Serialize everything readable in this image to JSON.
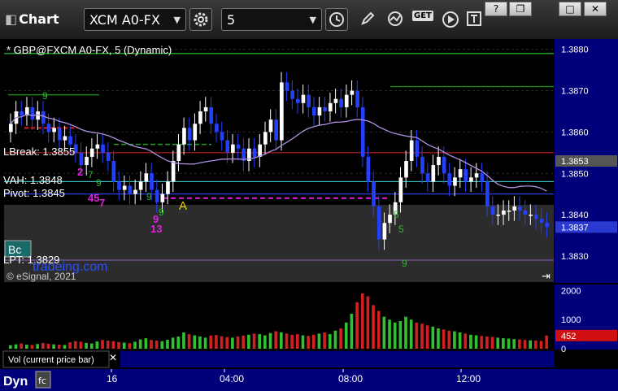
{
  "toolbar": {
    "app_label": "Chart",
    "symbol": "XCM A0-FX",
    "interval": "5",
    "get_label": "GET"
  },
  "chart_header": "* GBP@FXCM A0-FX, 5 (Dynamic)",
  "copyright": "© eSignal, 2021",
  "vol_label": "Vol (current price bar)",
  "dyn_label": "Dyn",
  "studies": {
    "lbreak": "LBreak: 1.3855",
    "vah": "VAH: 1.3848",
    "pivot": "Pivot: 1.3845",
    "lpt": "LPT: 1.3829",
    "watermark": "tradeing.com",
    "marker_a": "A",
    "badge": "Bc"
  },
  "colors": {
    "bull_candle": "#ffffff",
    "bear_candle": "#2440ff",
    "vah_line": "#40e0e0",
    "pivot_line": "#3040ff",
    "lbreak_line": "#c02020",
    "vwap_line": "#b090e0",
    "lpt_line": "#9060c0",
    "top_green_line": "#20a020",
    "current_price_tag": "#2a3ad0",
    "vol_tag": "#d01010"
  },
  "chart_data": [
    {
      "type": "candlestick",
      "title": "* GBP@FXCM A0-FX, 5 (Dynamic)",
      "y_ticks": [
        1.388,
        1.387,
        1.386,
        1.385,
        1.384,
        1.383
      ],
      "y_tick_labels": [
        "1.3880",
        "1.3870",
        "1.3860",
        "1.3850",
        "1.3840",
        "1.3830"
      ],
      "ylim": [
        1.38235,
        1.38825
      ],
      "x_tick_labels": [
        "16",
        "04:00",
        "08:00",
        "12:00"
      ],
      "price_tags": [
        {
          "value": 1.3853,
          "label": "1.3853"
        },
        {
          "value": 1.3837,
          "label": "1.3837"
        }
      ],
      "levels": {
        "lbreak": 1.3855,
        "vah": 1.3848,
        "pivot": 1.3845,
        "lpt": 1.3829,
        "upper_green": 1.3879
      },
      "td_counts_green": [
        "9",
        "7",
        "9",
        "9",
        "9",
        "5",
        "5",
        "9"
      ],
      "td_counts_magenta": [
        "2",
        "45",
        "7",
        "9",
        "13"
      ],
      "closes": [
        1.3862,
        1.3865,
        1.3864,
        1.3866,
        1.3863,
        1.3865,
        1.3862,
        1.386,
        1.3861,
        1.3858,
        1.3859,
        1.3857,
        1.3855,
        1.3852,
        1.3854,
        1.3856,
        1.3857,
        1.3855,
        1.3853,
        1.3848,
        1.3846,
        1.3847,
        1.3845,
        1.3846,
        1.3848,
        1.385,
        1.3846,
        1.3843,
        1.3845,
        1.3848,
        1.3853,
        1.3857,
        1.3861,
        1.3858,
        1.3862,
        1.3865,
        1.3866,
        1.3862,
        1.386,
        1.3858,
        1.3855,
        1.3857,
        1.3856,
        1.3853,
        1.3856,
        1.3854,
        1.3857,
        1.386,
        1.3863,
        1.3858,
        1.3872,
        1.387,
        1.3868,
        1.3867,
        1.3869,
        1.3866,
        1.3864,
        1.3866,
        1.3865,
        1.3867,
        1.3868,
        1.3866,
        1.3869,
        1.387,
        1.3866,
        1.3854,
        1.3848,
        1.3842,
        1.3834,
        1.3838,
        1.384,
        1.3843,
        1.3849,
        1.3853,
        1.3858,
        1.3854,
        1.385,
        1.3848,
        1.3852,
        1.3854,
        1.385,
        1.3847,
        1.3849,
        1.3851,
        1.3848,
        1.3849,
        1.385,
        1.3848,
        1.3842,
        1.384,
        1.384,
        1.3841,
        1.3841,
        1.3842,
        1.3841,
        1.384,
        1.384,
        1.3839,
        1.3838,
        1.3837
      ]
    },
    {
      "type": "bar",
      "title": "Vol (current price bar)",
      "y_ticks": [
        0,
        1000,
        2000
      ],
      "y_tick_labels": [
        "0",
        "1000",
        "2000"
      ],
      "ylim": [
        0,
        2150
      ],
      "current_value": 452,
      "current_label": "452",
      "values": [
        120,
        150,
        180,
        140,
        130,
        160,
        200,
        170,
        150,
        140,
        130,
        220,
        260,
        240,
        200,
        180,
        250,
        300,
        280,
        260,
        230,
        210,
        190,
        240,
        320,
        360,
        300,
        280,
        260,
        310,
        380,
        420,
        560,
        500,
        460,
        420,
        380,
        450,
        470,
        430,
        400,
        380,
        420,
        450,
        480,
        520,
        500,
        460,
        540,
        600,
        560,
        520,
        480,
        500,
        460,
        440,
        480,
        520,
        560,
        500,
        620,
        700,
        900,
        1200,
        1600,
        1900,
        1800,
        1500,
        1300,
        1100,
        1000,
        900,
        950,
        1100,
        1000,
        900,
        860,
        800,
        760,
        700,
        660,
        620,
        600,
        560,
        520,
        480,
        460,
        440,
        420,
        400,
        380,
        360,
        350,
        330,
        320,
        300,
        290,
        280,
        270,
        452
      ]
    }
  ]
}
